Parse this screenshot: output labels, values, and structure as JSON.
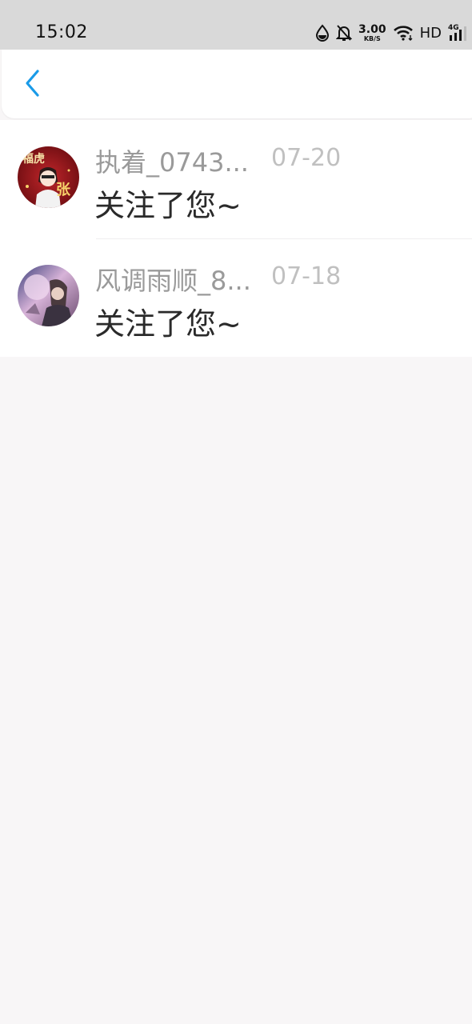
{
  "status_bar": {
    "time": "15:02",
    "net_speed_value": "3.00",
    "net_speed_unit": "KB/S",
    "hd_label": "HD",
    "network_type": "4G",
    "icons": [
      "data-saver-icon",
      "mute-bell-icon",
      "wifi-icon",
      "signal-icon"
    ]
  },
  "nav": {
    "back_icon": "chevron-left-icon",
    "accent_color": "#1a9be8"
  },
  "notifications": [
    {
      "name": "执着_0743...",
      "date": "07-20",
      "message": "关注了您~",
      "avatar": "avatar-red-festive"
    },
    {
      "name": "风调雨顺_8...",
      "date": "07-18",
      "message": "关注了您~",
      "avatar": "avatar-anime-purple"
    }
  ]
}
